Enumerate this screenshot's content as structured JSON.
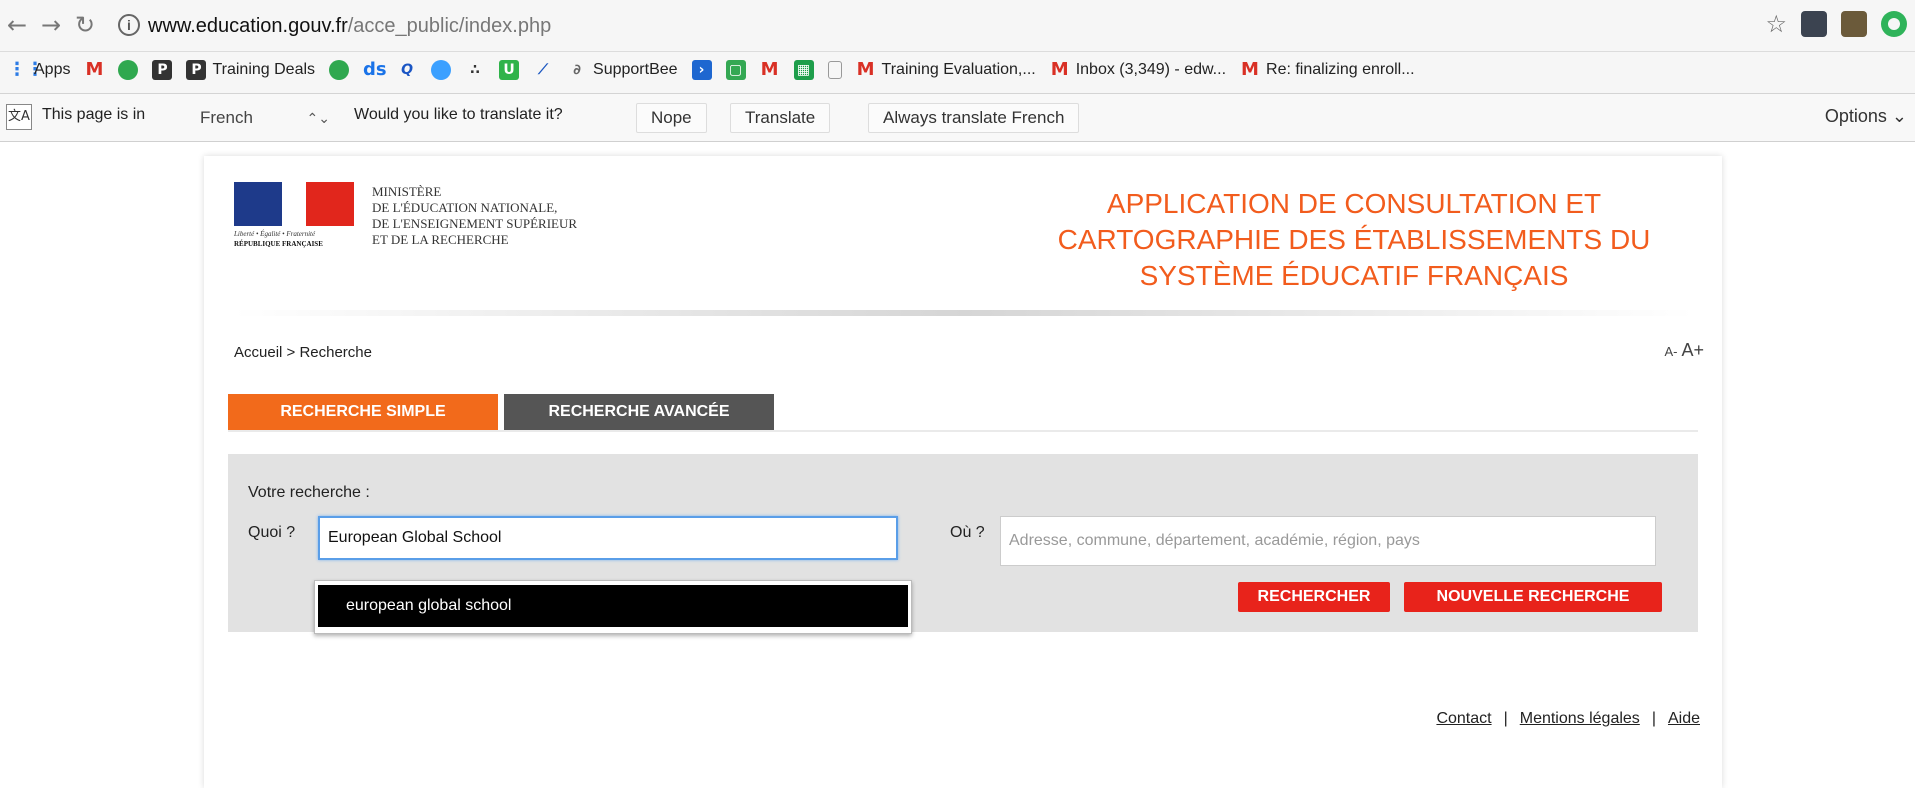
{
  "browser": {
    "url_host": "www.education.gouv.fr",
    "url_path": "/acce_public/index.php"
  },
  "bookmarks": [
    {
      "label": "Apps",
      "icon": "apps-grid-icon"
    },
    {
      "label": "",
      "icon": "gmail-icon"
    },
    {
      "label": "",
      "icon": "green-circle-icon"
    },
    {
      "label": "",
      "icon": "p-icon"
    },
    {
      "label": "Training Deals",
      "icon": "p-icon"
    },
    {
      "label": "",
      "icon": "green-dot-icon"
    },
    {
      "label": "",
      "icon": "ds-icon"
    },
    {
      "label": "",
      "icon": "q-icon"
    },
    {
      "label": "",
      "icon": "blue-circle-icon"
    },
    {
      "label": "",
      "icon": "triangle-icon"
    },
    {
      "label": "",
      "icon": "u-icon"
    },
    {
      "label": "",
      "icon": "chart-icon"
    },
    {
      "label": "SupportBee",
      "icon": "link-icon"
    },
    {
      "label": "",
      "icon": "arrow-icon"
    },
    {
      "label": "",
      "icon": "square-icon"
    },
    {
      "label": "",
      "icon": "gmail-icon"
    },
    {
      "label": "",
      "icon": "sheet-icon"
    },
    {
      "label": "",
      "icon": "doc-icon"
    },
    {
      "label": "Training Evaluation,...",
      "icon": "gmail-icon"
    },
    {
      "label": "Inbox (3,349) - edw...",
      "icon": "gmail-icon"
    },
    {
      "label": "Re: finalizing enroll...",
      "icon": "gmail-icon"
    }
  ],
  "translate_bar": {
    "prefix": "This page is in",
    "language": "French",
    "question": "Would you like to translate it?",
    "nope": "Nope",
    "translate": "Translate",
    "always": "Always translate French",
    "options": "Options"
  },
  "header": {
    "ministry_lines": [
      "MINISTÈRE",
      "DE L'ÉDUCATION NATIONALE,",
      "DE L'ENSEIGNEMENT SUPÉRIEUR",
      "ET DE LA RECHERCHE"
    ],
    "motto": "Liberté • Égalité • Fraternité",
    "republic": "RÉPUBLIQUE FRANÇAISE",
    "title_lines": [
      "APPLICATION DE CONSULTATION ET",
      "CARTOGRAPHIE DES ÉTABLISSEMENTS DU",
      "SYSTÈME ÉDUCATIF FRANÇAIS"
    ]
  },
  "breadcrumb": "Accueil > Recherche",
  "font_controls": {
    "decrease": "A-",
    "increase": "A+"
  },
  "tabs": {
    "simple": "RECHERCHE SIMPLE",
    "advanced": "RECHERCHE AVANCÉE"
  },
  "search": {
    "heading": "Votre recherche :",
    "quoi_label": "Quoi ?",
    "quoi_value": "European Global School",
    "ou_label": "Où ?",
    "ou_placeholder": "Adresse, commune, département, académie, région, pays",
    "search_button": "RECHERCHER",
    "new_button": "NOUVELLE RECHERCHE",
    "suggestion": "european global school"
  },
  "footer": {
    "contact": "Contact",
    "legal": "Mentions légales",
    "help": "Aide"
  },
  "colors": {
    "accent": "#f25c1d",
    "button_red": "#e8231b",
    "tab_dark": "#555555"
  }
}
